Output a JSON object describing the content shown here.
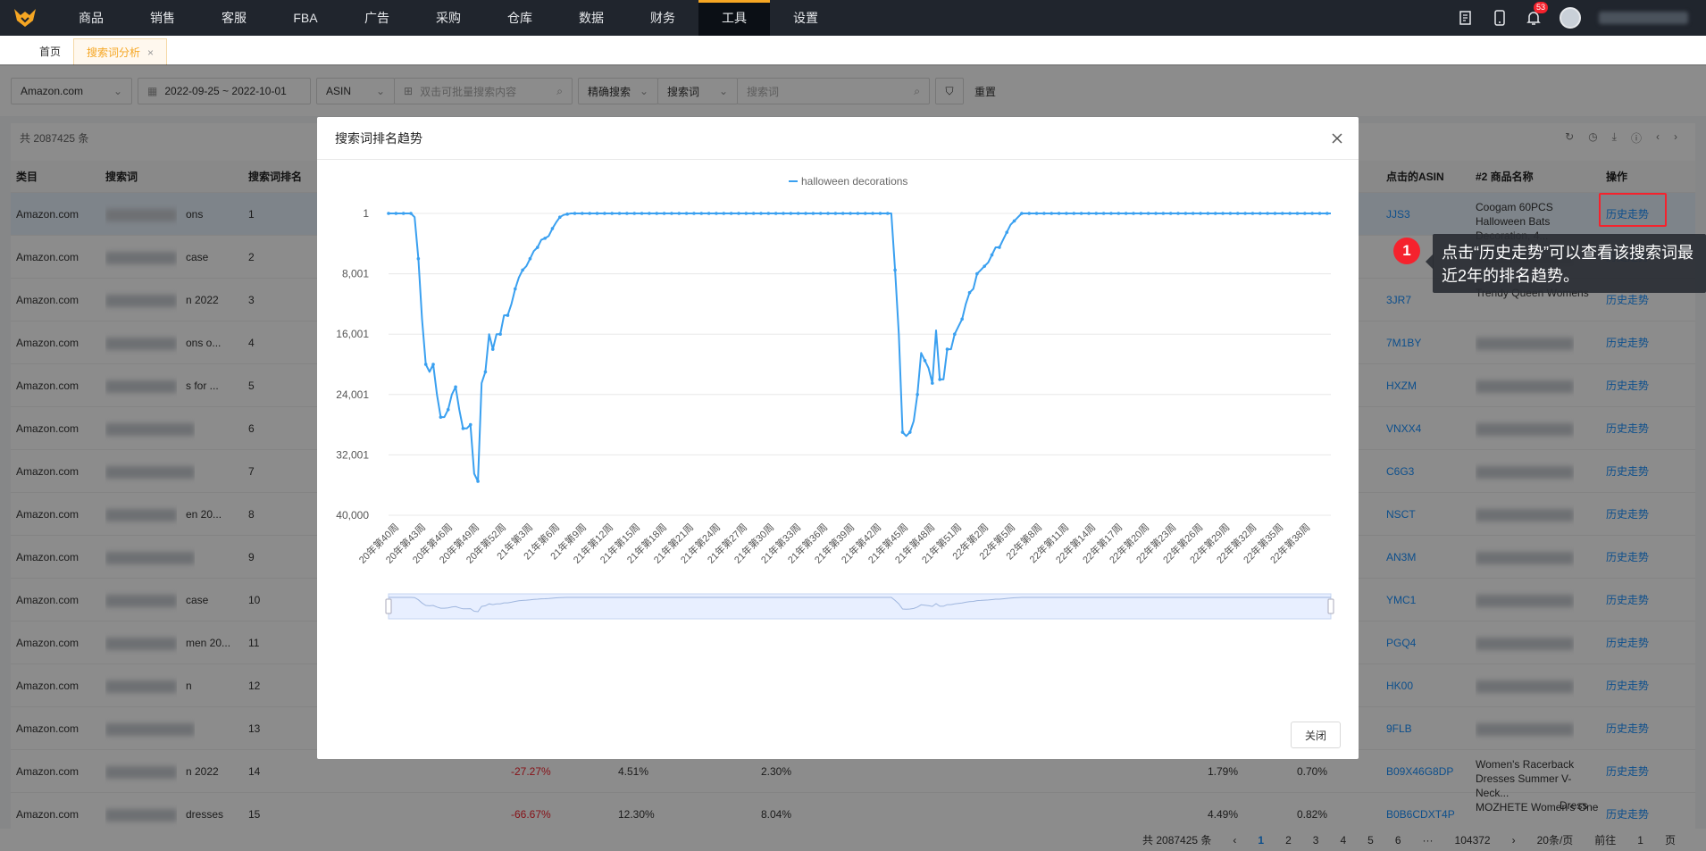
{
  "nav": {
    "items": [
      "商品",
      "销售",
      "客服",
      "FBA",
      "广告",
      "采购",
      "仓库",
      "数据",
      "财务",
      "工具",
      "设置"
    ],
    "active_index": 9,
    "notification_count": "53"
  },
  "tabs": [
    {
      "label": "首页",
      "active": false
    },
    {
      "label": "搜索词分析",
      "active": true,
      "close": "×"
    }
  ],
  "filters": {
    "marketplace": "Amazon.com",
    "date_range": "2022-09-25 ~ 2022-10-01",
    "asin_type": "ASIN",
    "asin_placeholder": "双击可批量搜索内容",
    "match_mode": "精确搜索",
    "search_field": "搜索词",
    "search_placeholder": "搜索词",
    "reset_label": "重置"
  },
  "table": {
    "total_label": "共 2087425 条",
    "headers": {
      "category": "类目",
      "search_term": "搜索词",
      "rank": "搜索词排名",
      "asin": "点击的ASIN",
      "product_name": "#2 商品名称",
      "action": "操作"
    },
    "rows": [
      {
        "category": "Amazon.com",
        "term_suffix": "ons",
        "rank": "1",
        "asin": "JJS3",
        "name": "Coogam 60PCS Halloween Bats Decoration, 4...",
        "action": "历史走势"
      },
      {
        "category": "Amazon.com",
        "term_suffix": "case",
        "rank": "2",
        "asin": "",
        "name": "",
        "action": "历史走势"
      },
      {
        "category": "Amazon.com",
        "term_suffix": "n 2022",
        "rank": "3",
        "asin": "3JR7",
        "name": "Trendy Queen Womens",
        "action": "历史走势"
      },
      {
        "category": "Amazon.com",
        "term_suffix": "ons o...",
        "rank": "4",
        "asin": "7M1BY",
        "name": "",
        "action": "历史走势"
      },
      {
        "category": "Amazon.com",
        "term_suffix": "s for ...",
        "rank": "5",
        "asin": "HXZM",
        "name": "",
        "action": "历史走势"
      },
      {
        "category": "Amazon.com",
        "term_suffix": "",
        "rank": "6",
        "asin": "VNXX4",
        "name": "",
        "action": "历史走势"
      },
      {
        "category": "Amazon.com",
        "term_suffix": "",
        "rank": "7",
        "asin": "C6G3",
        "name": "",
        "action": "历史走势"
      },
      {
        "category": "Amazon.com",
        "term_suffix": "en 20...",
        "rank": "8",
        "asin": "NSCT",
        "name": "",
        "action": "历史走势"
      },
      {
        "category": "Amazon.com",
        "term_suffix": "",
        "rank": "9",
        "asin": "AN3M",
        "name": "",
        "action": "历史走势"
      },
      {
        "category": "Amazon.com",
        "term_suffix": "case",
        "rank": "10",
        "asin": "YMC1",
        "name": "",
        "action": "历史走势"
      },
      {
        "category": "Amazon.com",
        "term_suffix": "men 20...",
        "rank": "11",
        "asin": "PGQ4",
        "name": "",
        "action": "历史走势"
      },
      {
        "category": "Amazon.com",
        "term_suffix": "n",
        "rank": "12",
        "asin": "HK00",
        "name": "",
        "action": "历史走势"
      },
      {
        "category": "Amazon.com",
        "term_suffix": "",
        "rank": "13",
        "asin": "9FLB",
        "name": "",
        "action": "历史走势"
      },
      {
        "category": "Amazon.com",
        "term_suffix": "n 2022",
        "rank": "14",
        "change": "-27.27%",
        "share1": "4.51%",
        "share2": "2.30%",
        "asin": "B09X46G8DP",
        "name": "Women's Racerback Dresses Summer V-Neck...",
        "pct1": "1.79%",
        "pct2": "0.70%",
        "action": "历史走势"
      },
      {
        "category": "Amazon.com",
        "term_suffix": "dresses",
        "rank": "15",
        "change": "-66.67%",
        "share1": "12.30%",
        "share2": "8.04%",
        "asin": "B0B6CDXT4P",
        "name": "MOZHETE Women's One",
        "pct1": "4.49%",
        "pct2": "0.82%",
        "extra": "Dress",
        "action": "历史走势"
      }
    ]
  },
  "pager": {
    "total": "共 2087425 条",
    "pages": [
      "1",
      "2",
      "3",
      "4",
      "5",
      "6",
      "···",
      "104372"
    ],
    "page_size": "20条/页",
    "goto_label": "前往",
    "goto_value": "1",
    "page_unit": "页"
  },
  "modal": {
    "title": "搜索词排名趋势",
    "close_label": "关闭",
    "close_icon": "close-icon"
  },
  "callout": {
    "step": "1",
    "text": "点击“历史走势”可以查看该搜索词最近2年的排名趋势。"
  },
  "chart_data": {
    "type": "line",
    "title": "",
    "legend": [
      "halloween decorations"
    ],
    "legend_position": "top-center",
    "series_color": "#3aa0f0",
    "y_inverted": true,
    "ylim": [
      1,
      40000
    ],
    "y_ticks": [
      "1",
      "8,001",
      "16,001",
      "24,001",
      "32,001",
      "40,000"
    ],
    "y_tick_values": [
      1,
      8001,
      16001,
      24001,
      32001,
      40000
    ],
    "x_tick_labels": [
      "20年第40周",
      "20年第43周",
      "20年第46周",
      "20年第49周",
      "20年第52周",
      "21年第3周",
      "21年第6周",
      "21年第9周",
      "21年第12周",
      "21年第15周",
      "21年第18周",
      "21年第21周",
      "21年第24周",
      "21年第27周",
      "21年第30周",
      "21年第33周",
      "21年第36周",
      "21年第39周",
      "21年第42周",
      "21年第45周",
      "21年第48周",
      "21年第51周",
      "22年第2周",
      "22年第5周",
      "22年第8周",
      "22年第11周",
      "22年第14周",
      "22年第17周",
      "22年第20周",
      "22年第23周",
      "22年第26周",
      "22年第29周",
      "22年第32周",
      "22年第35周",
      "22年第38周"
    ],
    "series": [
      {
        "name": "halloween decorations",
        "values": [
          1,
          1,
          1,
          1,
          1,
          1,
          1,
          500,
          6000,
          14000,
          20000,
          21000,
          20000,
          24000,
          27000,
          27000,
          26000,
          24000,
          23000,
          26000,
          28500,
          28500,
          28000,
          34500,
          35500,
          22500,
          21000,
          16000,
          18000,
          16000,
          16000,
          13500,
          13500,
          12000,
          10000,
          8500,
          7500,
          7000,
          6000,
          5000,
          4500,
          3500,
          3300,
          3000,
          2000,
          1200,
          500,
          200,
          100,
          1,
          1,
          1,
          1,
          1,
          1,
          1,
          1,
          1,
          1,
          1,
          1,
          1,
          1,
          1,
          1,
          1,
          1,
          1,
          1,
          1,
          1,
          1,
          1,
          1,
          1,
          1,
          1,
          1,
          1,
          1,
          1,
          1,
          1,
          1,
          1,
          1,
          1,
          1,
          1,
          1,
          1,
          1,
          1,
          1,
          1,
          1,
          1,
          1,
          1,
          1,
          1,
          1,
          1,
          1,
          1,
          1,
          1,
          1,
          1,
          1,
          1,
          1,
          1,
          1,
          1,
          1,
          1,
          1,
          1,
          1,
          1,
          1,
          1,
          1,
          1,
          1,
          1,
          1,
          1,
          1,
          1,
          1,
          1,
          1,
          1,
          1,
          7500,
          16000,
          29000,
          29500,
          29000,
          27500,
          24000,
          18500,
          19500,
          20500,
          22500,
          15500,
          22000,
          22000,
          18000,
          18000,
          16000,
          15000,
          14000,
          12000,
          10500,
          10000,
          8000,
          7500,
          7000,
          6500,
          5500,
          4500,
          4500,
          3500,
          2500,
          1500,
          1000,
          500,
          1,
          1,
          1,
          1,
          1,
          1,
          1,
          1,
          1,
          1,
          1,
          1,
          1,
          1,
          1,
          1,
          1,
          1,
          1,
          1,
          1,
          1,
          1,
          1,
          1,
          1,
          1,
          1,
          1,
          1,
          1,
          1,
          1,
          1,
          1,
          1,
          1,
          1,
          1,
          1,
          1,
          1,
          1,
          1,
          1,
          1,
          1,
          1,
          1,
          1,
          1,
          1,
          1,
          1,
          1,
          1,
          1,
          1,
          1,
          1,
          1,
          1,
          1,
          1,
          1,
          1,
          1,
          1,
          1,
          1,
          1,
          1,
          1,
          1,
          1,
          1,
          1,
          1,
          1,
          1,
          1,
          1,
          1,
          1
        ]
      }
    ]
  }
}
